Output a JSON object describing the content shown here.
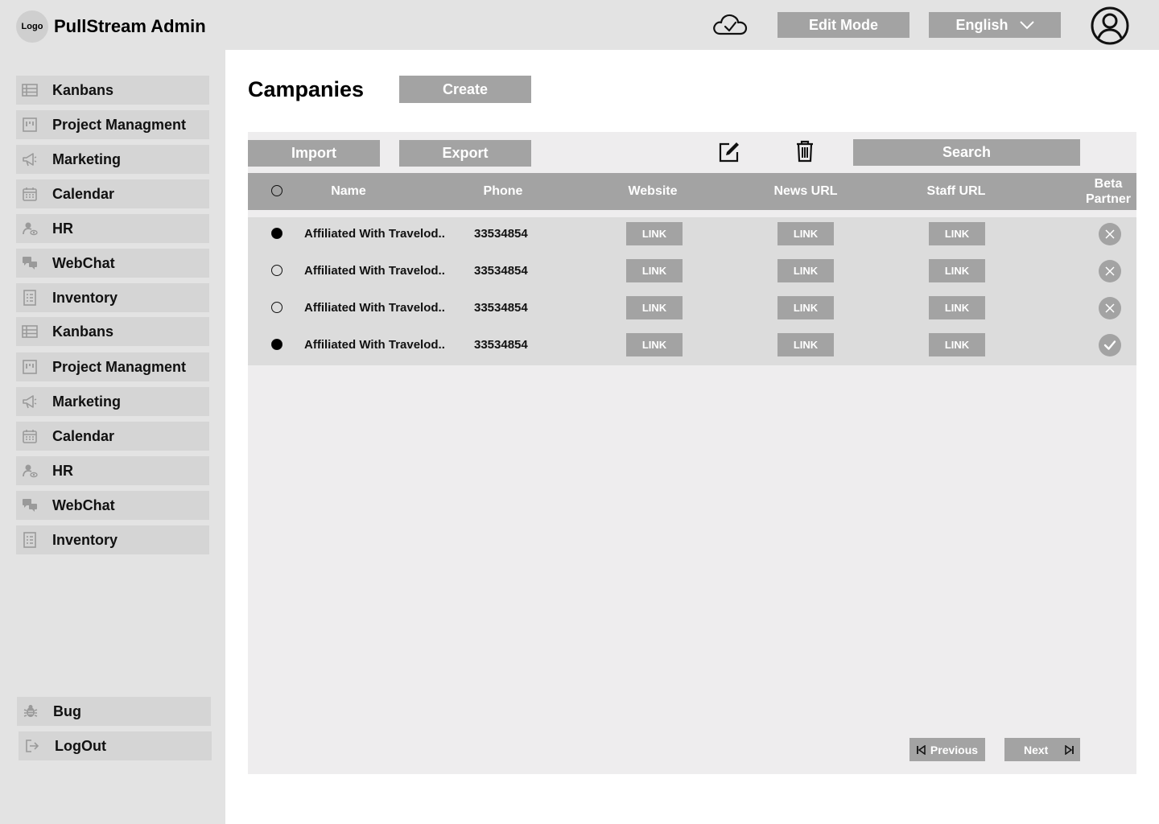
{
  "header": {
    "logo_text": "Logo",
    "app_title": "PullStream Admin",
    "edit_mode_label": "Edit Mode",
    "language_label": "English"
  },
  "sidebar": {
    "items": [
      {
        "label": "Kanbans",
        "icon": "kanban-icon"
      },
      {
        "label": "Project Managment",
        "icon": "project-board-icon"
      },
      {
        "label": "Marketing",
        "icon": "megaphone-icon"
      },
      {
        "label": "Calendar",
        "icon": "calendar-icon"
      },
      {
        "label": "HR",
        "icon": "person-eye-icon"
      },
      {
        "label": "WebChat",
        "icon": "chat-bubbles-icon"
      },
      {
        "label": "Inventory",
        "icon": "inventory-form-icon"
      },
      {
        "label": "Kanbans",
        "icon": "kanban-icon"
      },
      {
        "label": "Project Managment",
        "icon": "project-board-icon"
      },
      {
        "label": "Marketing",
        "icon": "megaphone-icon"
      },
      {
        "label": "Calendar",
        "icon": "calendar-icon"
      },
      {
        "label": "HR",
        "icon": "person-eye-icon"
      },
      {
        "label": "WebChat",
        "icon": "chat-bubbles-icon"
      },
      {
        "label": "Inventory",
        "icon": "inventory-form-icon"
      }
    ],
    "bottom": {
      "bug_label": "Bug",
      "logout_label": "LogOut"
    }
  },
  "main": {
    "title": "Campanies",
    "create_label": "Create",
    "toolbar": {
      "import_label": "Import",
      "export_label": "Export",
      "search_label": "Search"
    },
    "table": {
      "columns": {
        "name": "Name",
        "phone": "Phone",
        "website": "Website",
        "news_url": "News URL",
        "staff_url": "Staff URL",
        "beta_line1": "Beta",
        "beta_line2": "Partner"
      },
      "link_label": "LINK",
      "rows": [
        {
          "selected": true,
          "name": "Affiliated With Travelod..",
          "phone": "33534854",
          "beta_partner": false
        },
        {
          "selected": false,
          "name": "Affiliated With Travelod..",
          "phone": "33534854",
          "beta_partner": false
        },
        {
          "selected": false,
          "name": "Affiliated With Travelod..",
          "phone": "33534854",
          "beta_partner": false
        },
        {
          "selected": true,
          "name": "Affiliated With Travelod..",
          "phone": "33534854",
          "beta_partner": true
        }
      ]
    },
    "pagination": {
      "previous_label": "Previous",
      "next_label": "Next"
    }
  },
  "colors": {
    "topbar_bg": "#e3e3e3",
    "button_gray": "#a3a3a3",
    "panel_bg": "#eeedee",
    "row_bg": "#dcdcdc"
  }
}
